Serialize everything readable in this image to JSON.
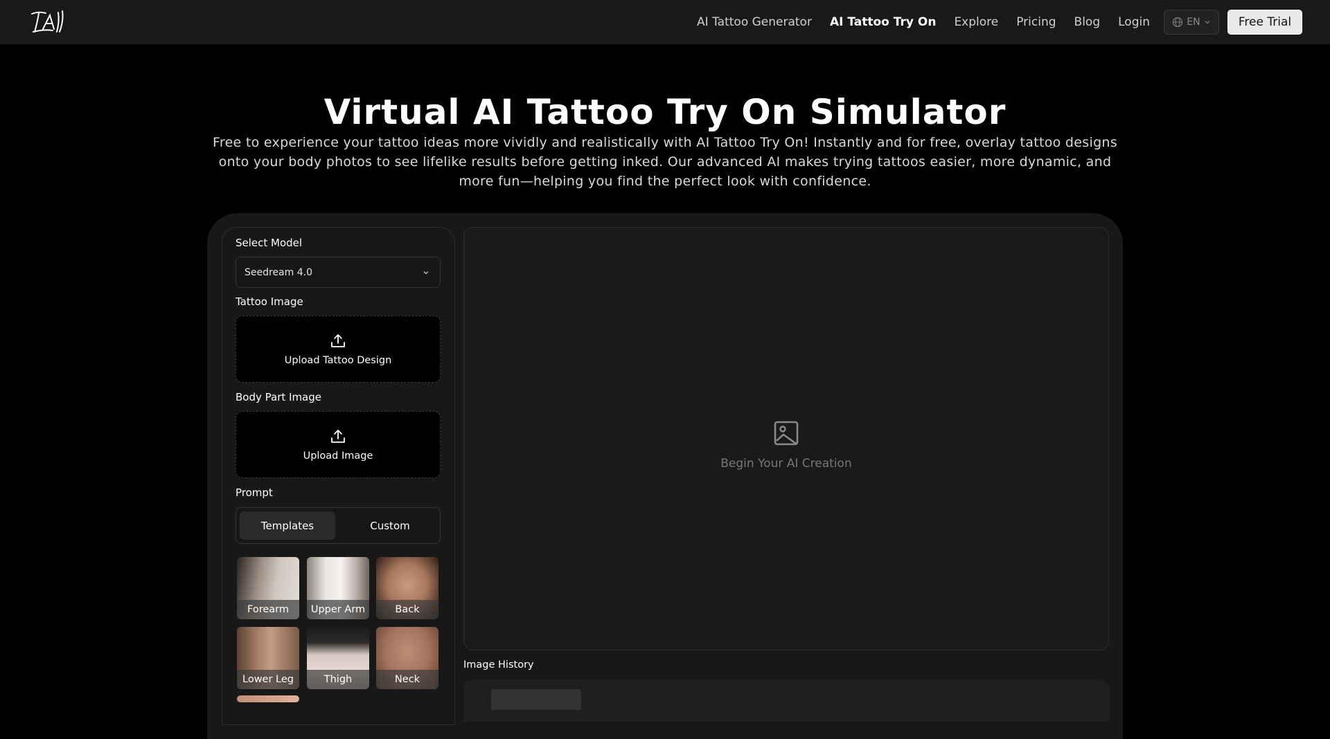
{
  "nav": {
    "logo_text": "TAI",
    "links": [
      {
        "label": "AI Tattoo Generator",
        "active": false
      },
      {
        "label": "AI Tattoo Try On",
        "active": true
      },
      {
        "label": "Explore",
        "active": false
      },
      {
        "label": "Pricing",
        "active": false
      },
      {
        "label": "Blog",
        "active": false
      },
      {
        "label": "Login",
        "active": false
      }
    ],
    "language": "EN",
    "cta": "Free Trial"
  },
  "hero": {
    "title": "Virtual AI Tattoo Try On Simulator",
    "description": "Free to experience your tattoo ideas more vividly and realistically with AI Tattoo Try On! Instantly and for free, overlay tattoo designs onto your body photos to see lifelike results before getting inked. Our advanced AI makes trying tattoos easier, more dynamic, and more fun—helping you find the perfect look with confidence."
  },
  "form": {
    "model_label": "Select Model",
    "model_value": "Seedream 4.0",
    "tattoo_label": "Tattoo Image",
    "tattoo_upload": "Upload Tattoo Design",
    "body_label": "Body Part Image",
    "body_upload": "Upload Image",
    "prompt_label": "Prompt",
    "tabs": [
      "Templates",
      "Custom"
    ],
    "templates": [
      {
        "name": "Forearm"
      },
      {
        "name": "Upper Arm"
      },
      {
        "name": "Back"
      },
      {
        "name": "Lower Leg"
      },
      {
        "name": "Thigh"
      },
      {
        "name": "Neck"
      }
    ]
  },
  "output": {
    "placeholder": "Begin Your AI Creation",
    "history_label": "Image History"
  },
  "colors": {
    "background": "#000000",
    "nav": "#191919",
    "card": "#181818",
    "accent_button": "#e9e9e9"
  }
}
